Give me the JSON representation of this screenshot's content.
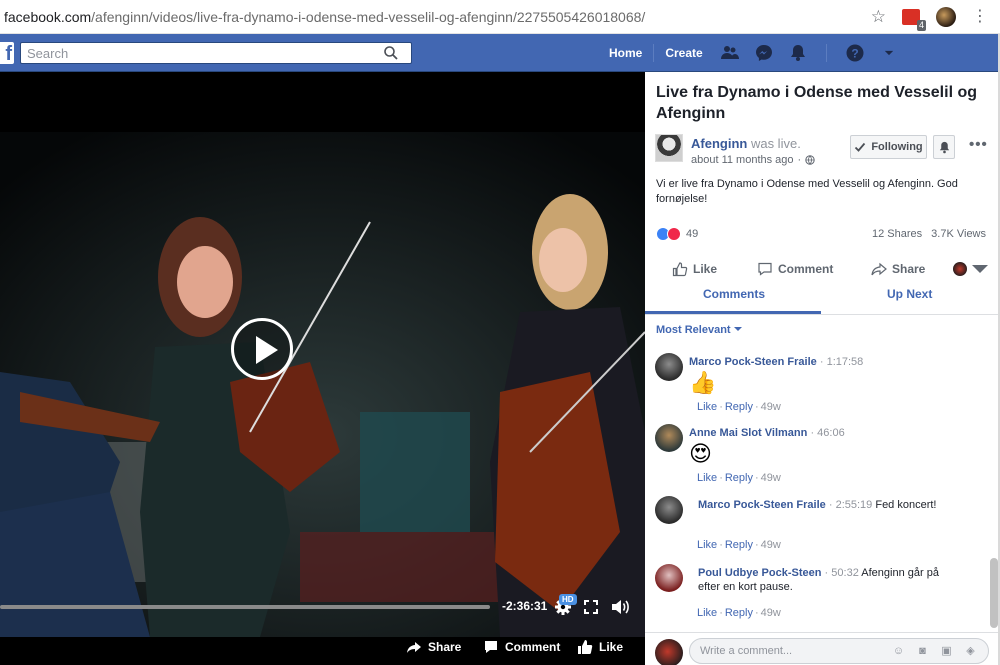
{
  "browser": {
    "url_domain": "facebook.com",
    "url_path": "/afenginn/videos/live-fra-dynamo-i-odense-med-vesselil-og-afenginn/2275505426018068/",
    "extension_badge": "4"
  },
  "topbar": {
    "logo": "f",
    "search_placeholder": "Search",
    "nav": [
      "Home",
      "Create"
    ],
    "brand_color": "#4267b2"
  },
  "video": {
    "time_remaining": "-2:36:31",
    "quality_badge": "HD",
    "actions": {
      "share": "Share",
      "comment": "Comment",
      "like": "Like"
    }
  },
  "post": {
    "title": "Live fra Dynamo i Odense med Vesselil og Afenginn",
    "author": "Afenginn",
    "status": "was live.",
    "timestamp": "about 11 months ago",
    "follow_label": "Following",
    "text": "Vi er live fra Dynamo i Odense med Vesselil og Afenginn. God fornøjelse!",
    "reaction_count": "49",
    "shares": "12 Shares",
    "views": "3.7K Views",
    "actions": {
      "like": "Like",
      "comment": "Comment",
      "share": "Share"
    }
  },
  "tabs": {
    "comments": "Comments",
    "up_next": "Up Next"
  },
  "sort_label": "Most Relevant",
  "comments": [
    {
      "name": "Marco Pock-Steen Fraile",
      "time": "1:17:58",
      "text": "",
      "emoji": "👍",
      "like": "Like",
      "reply": "Reply",
      "age": "49w"
    },
    {
      "name": "Anne Mai Slot Vilmann",
      "time": "46:06",
      "text": "",
      "emoji": "😍",
      "like": "Like",
      "reply": "Reply",
      "age": "49w"
    },
    {
      "name": "Marco Pock-Steen Fraile",
      "time": "2:55:19",
      "text": "Fed koncert!",
      "emoji": "",
      "like": "Like",
      "reply": "Reply",
      "age": "49w"
    },
    {
      "name": "Poul Udbye Pock-Steen",
      "time": "50:32",
      "text": "Afenginn går på efter en kort pause.",
      "emoji": "",
      "like": "Like",
      "reply": "Reply",
      "age": "49w"
    }
  ],
  "composer": {
    "placeholder": "Write a comment..."
  }
}
